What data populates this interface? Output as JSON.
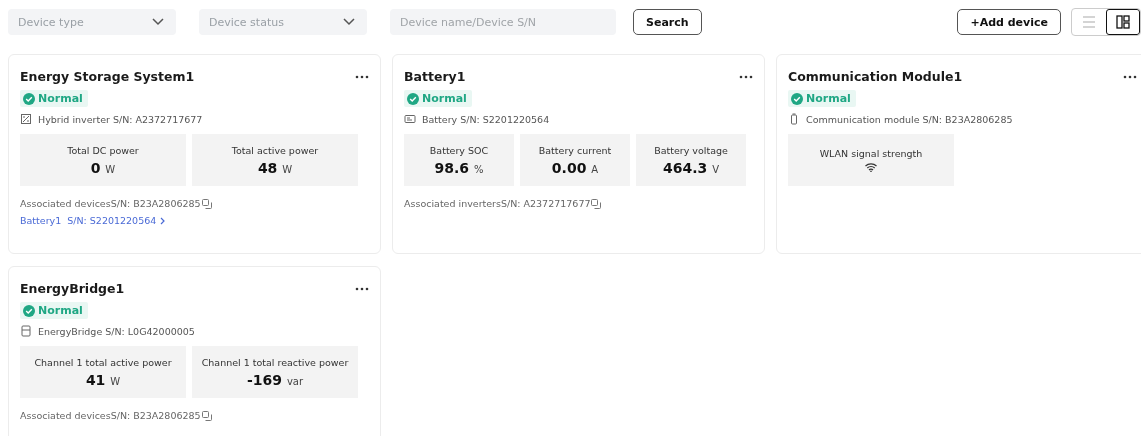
{
  "filters": {
    "device_type": {
      "placeholder": "Device type"
    },
    "device_status": {
      "placeholder": "Device status"
    },
    "search": {
      "placeholder": "Device name/Device S/N"
    },
    "search_button": "Search"
  },
  "add_device": "+Add device",
  "view_toggle": [
    {
      "kind": "list",
      "selected": false
    },
    {
      "kind": "grid",
      "selected": true
    }
  ],
  "cards": [
    {
      "title": "Energy Storage System1",
      "status": "Normal",
      "kind": "inverter",
      "device_sn": "Hybrid inverter S/N: A2372717677",
      "metrics": [
        {
          "kind": "value",
          "label": "Total DC power",
          "value": "0",
          "unit": "W"
        },
        {
          "kind": "value",
          "label": "Total active power",
          "value": "48",
          "unit": "W"
        }
      ],
      "associated": "Associated devicesS/N: B23A2806285",
      "linked": [
        {
          "name": "Battery1",
          "sn": "S/N: S2201220564"
        }
      ]
    },
    {
      "title": "Battery1",
      "status": "Normal",
      "kind": "battery",
      "device_sn": "Battery S/N: S2201220564",
      "metrics": [
        {
          "kind": "value",
          "label": "Battery SOC",
          "value": "98.6",
          "unit": "%"
        },
        {
          "kind": "value",
          "label": "Battery current",
          "value": "0.00",
          "unit": "A"
        },
        {
          "kind": "value",
          "label": "Battery voltage",
          "value": "464.3",
          "unit": "V"
        }
      ],
      "associated": "Associated invertersS/N: A2372717677"
    },
    {
      "title": "Communication Module1",
      "status": "Normal",
      "kind": "module",
      "device_sn": "Communication module S/N: B23A2806285",
      "metrics": [
        {
          "kind": "signal",
          "label": "WLAN signal strength"
        }
      ]
    },
    {
      "title": "EnergyBridge1",
      "status": "Normal",
      "kind": "bridge",
      "device_sn": "EnergyBridge S/N: L0G42000005",
      "metrics": [
        {
          "kind": "value",
          "label": "Channel 1 total active power",
          "value": "41",
          "unit": "W"
        },
        {
          "kind": "value",
          "label": "Channel 1 total reactive power",
          "value": "-169",
          "unit": "var"
        }
      ],
      "associated": "Associated devicesS/N: B23A2806285"
    }
  ]
}
